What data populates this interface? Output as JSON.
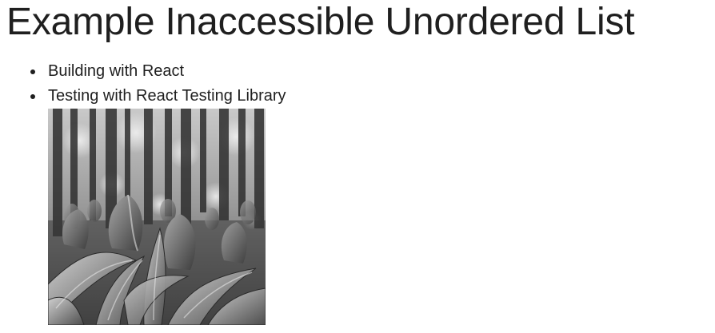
{
  "page": {
    "title": "Example Inaccessible Unordered List"
  },
  "list": {
    "items": [
      {
        "label": "Building with React"
      },
      {
        "label": "Testing with React Testing Library"
      }
    ]
  },
  "image": {
    "subject": "black-and-white photo of tulips in a forest",
    "colors": {
      "dark": "#2a2a2a",
      "mid": "#7a7a7a",
      "light": "#d8d8d8"
    }
  }
}
